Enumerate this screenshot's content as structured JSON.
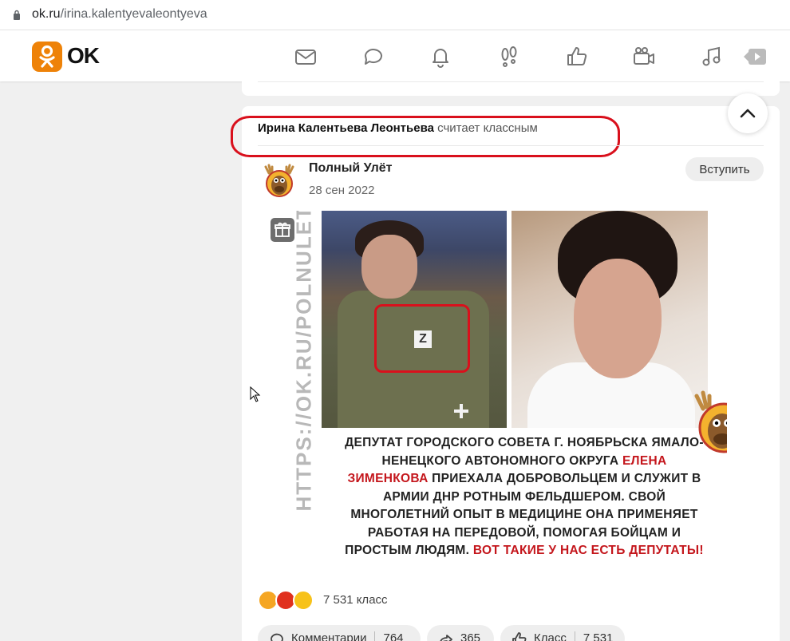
{
  "browser": {
    "url_host": "ok.ru",
    "url_path": "/irina.kalentyevaleontyeva"
  },
  "header": {
    "logo_text": "OK",
    "nav_icons": [
      "mail-icon",
      "chat-icon",
      "bell-icon",
      "guests-icon",
      "like-icon",
      "video-icon",
      "music-icon",
      "play-icon"
    ]
  },
  "post": {
    "liked_by": "Ирина Калентьева Леонтьева",
    "liked_action": "считает классным",
    "group_name": "Полный Улёт",
    "date": "28 сен 2022",
    "join_label": "Вступить",
    "watermark": "HTTPS://OK.RU/POLNULET",
    "caption_part1": "Депутат городского совета г. Ноябрьска Ямало-Ненецкого автономного округа ",
    "caption_red1": "Елена Зименкова",
    "caption_part2": " приехала добровольцем и служит в армии ДНР ротным фельдшером. Свой многолетний опыт в медицине она применяет работая на передовой, помогая бойцам и простым людям. ",
    "caption_red2": "Вот такие у нас есть депутаты!",
    "zmark": "Z",
    "reactions_count": "7 531 класс",
    "actions": {
      "comments_label": "Комментарии",
      "comments_count": "764",
      "share_count": "365",
      "class_label": "Класс",
      "class_count": "7 531"
    }
  },
  "colors": {
    "brand": "#ee8208",
    "highlight": "#d9101c",
    "caption_red": "#c4161c"
  }
}
